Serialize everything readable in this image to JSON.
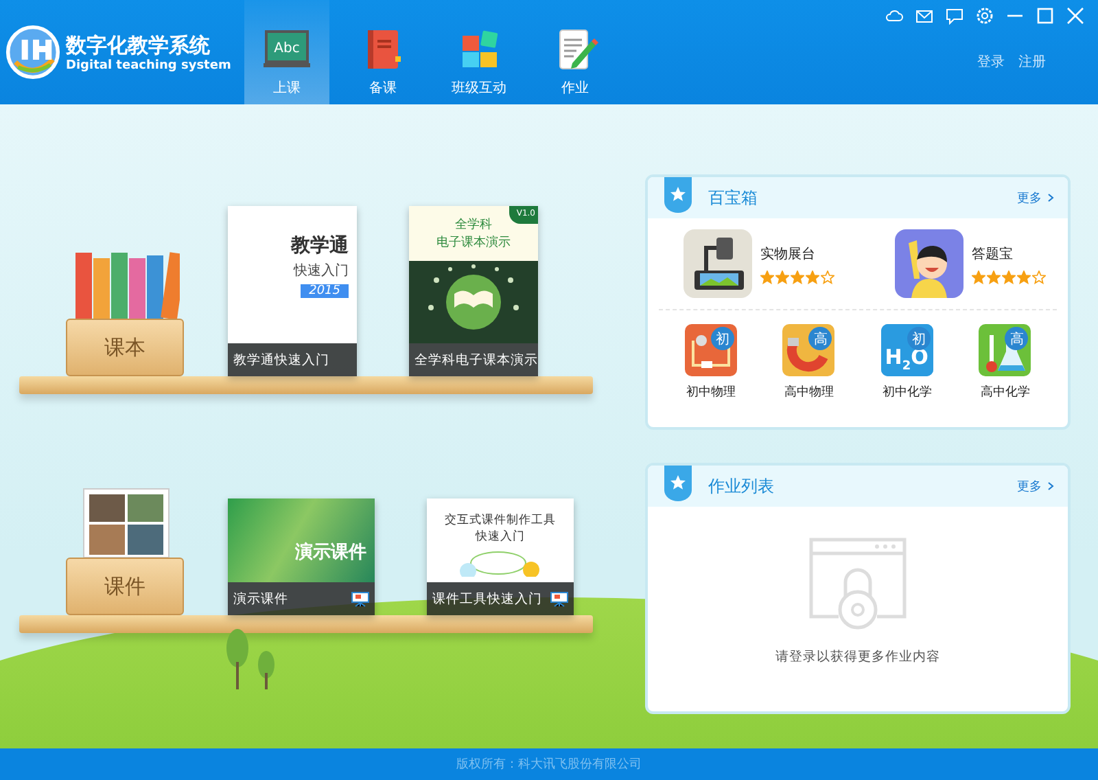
{
  "header": {
    "logo": {
      "title": "数字化教学系统",
      "subtitle": "Digital teaching system"
    },
    "tabs": [
      {
        "label": "上课",
        "kind": "board",
        "icon_text": "Abc",
        "selected": true
      },
      {
        "label": "备课",
        "kind": "book",
        "selected": false
      },
      {
        "label": "班级互动",
        "kind": "blocks",
        "selected": false
      },
      {
        "label": "作业",
        "kind": "notepad",
        "selected": false
      }
    ],
    "account_links": [
      "登录",
      "注册"
    ]
  },
  "shelves": [
    {
      "bin_label": "课本",
      "kind": "textbook",
      "items": [
        {
          "caption": "教学通快速入门",
          "kind": "guide",
          "cover_lines": [
            "教学通",
            "快速入门"
          ],
          "cover_tag": "2015"
        },
        {
          "caption": "全学科电子课本演示",
          "kind": "ebook",
          "cover_lines": [
            "全学科",
            "电子课本演示"
          ],
          "cover_tag": "V1.0"
        }
      ]
    },
    {
      "bin_label": "课件",
      "kind": "courseware",
      "items": [
        {
          "caption": "演示课件",
          "kind": "slides",
          "cover_lines": [
            "演示课件"
          ]
        },
        {
          "caption": "课件工具快速入门",
          "kind": "tool",
          "cover_lines": [
            "交互式课件制作工具",
            "快速入门"
          ]
        }
      ]
    }
  ],
  "toolbox": {
    "title": "百宝箱",
    "more": "更多",
    "featured": [
      {
        "name": "实物展台",
        "kind": "projector",
        "stars": 4
      },
      {
        "name": "答题宝",
        "kind": "kid",
        "stars": 4
      }
    ],
    "subjects": [
      {
        "name": "初中物理",
        "kind": "circuit",
        "badge": "初"
      },
      {
        "name": "高中物理",
        "kind": "magnet",
        "badge": "高"
      },
      {
        "name": "初中化学",
        "kind": "water",
        "badge": "初",
        "formula": "H$_{2}$O"
      },
      {
        "name": "高中化学",
        "kind": "flask",
        "badge": "高"
      }
    ]
  },
  "homework": {
    "title": "作业列表",
    "more": "更多",
    "empty_message": "请登录以获得更多作业内容"
  },
  "footer": "版权所有：科大讯飞股份有限公司"
}
